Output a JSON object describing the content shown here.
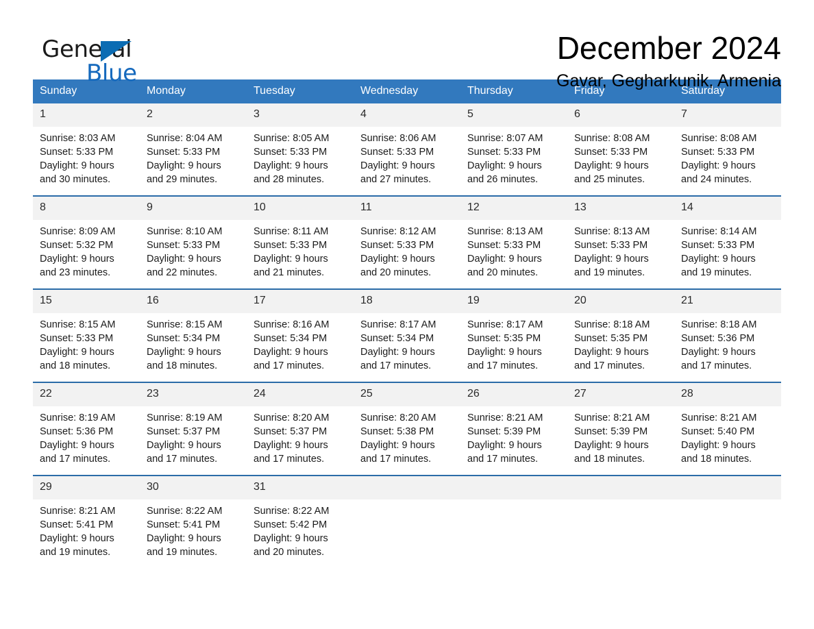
{
  "brand": {
    "name_part1": "General",
    "name_part2": "Blue",
    "triangle_icon": "triangle-icon",
    "accent_color": "#1569bd"
  },
  "header": {
    "title": "December 2024",
    "subtitle": "Gavar, Gegharkunik, Armenia"
  },
  "theme": {
    "header_row_bg": "#3279be",
    "daynum_bg": "#f2f2f2",
    "week_separator": "#2b6ca8"
  },
  "weekdays": [
    "Sunday",
    "Monday",
    "Tuesday",
    "Wednesday",
    "Thursday",
    "Friday",
    "Saturday"
  ],
  "weeks": [
    [
      {
        "day": "1",
        "sunrise": "Sunrise: 8:03 AM",
        "sunset": "Sunset: 5:33 PM",
        "daylight1": "Daylight: 9 hours",
        "daylight2": "and 30 minutes."
      },
      {
        "day": "2",
        "sunrise": "Sunrise: 8:04 AM",
        "sunset": "Sunset: 5:33 PM",
        "daylight1": "Daylight: 9 hours",
        "daylight2": "and 29 minutes."
      },
      {
        "day": "3",
        "sunrise": "Sunrise: 8:05 AM",
        "sunset": "Sunset: 5:33 PM",
        "daylight1": "Daylight: 9 hours",
        "daylight2": "and 28 minutes."
      },
      {
        "day": "4",
        "sunrise": "Sunrise: 8:06 AM",
        "sunset": "Sunset: 5:33 PM",
        "daylight1": "Daylight: 9 hours",
        "daylight2": "and 27 minutes."
      },
      {
        "day": "5",
        "sunrise": "Sunrise: 8:07 AM",
        "sunset": "Sunset: 5:33 PM",
        "daylight1": "Daylight: 9 hours",
        "daylight2": "and 26 minutes."
      },
      {
        "day": "6",
        "sunrise": "Sunrise: 8:08 AM",
        "sunset": "Sunset: 5:33 PM",
        "daylight1": "Daylight: 9 hours",
        "daylight2": "and 25 minutes."
      },
      {
        "day": "7",
        "sunrise": "Sunrise: 8:08 AM",
        "sunset": "Sunset: 5:33 PM",
        "daylight1": "Daylight: 9 hours",
        "daylight2": "and 24 minutes."
      }
    ],
    [
      {
        "day": "8",
        "sunrise": "Sunrise: 8:09 AM",
        "sunset": "Sunset: 5:32 PM",
        "daylight1": "Daylight: 9 hours",
        "daylight2": "and 23 minutes."
      },
      {
        "day": "9",
        "sunrise": "Sunrise: 8:10 AM",
        "sunset": "Sunset: 5:33 PM",
        "daylight1": "Daylight: 9 hours",
        "daylight2": "and 22 minutes."
      },
      {
        "day": "10",
        "sunrise": "Sunrise: 8:11 AM",
        "sunset": "Sunset: 5:33 PM",
        "daylight1": "Daylight: 9 hours",
        "daylight2": "and 21 minutes."
      },
      {
        "day": "11",
        "sunrise": "Sunrise: 8:12 AM",
        "sunset": "Sunset: 5:33 PM",
        "daylight1": "Daylight: 9 hours",
        "daylight2": "and 20 minutes."
      },
      {
        "day": "12",
        "sunrise": "Sunrise: 8:13 AM",
        "sunset": "Sunset: 5:33 PM",
        "daylight1": "Daylight: 9 hours",
        "daylight2": "and 20 minutes."
      },
      {
        "day": "13",
        "sunrise": "Sunrise: 8:13 AM",
        "sunset": "Sunset: 5:33 PM",
        "daylight1": "Daylight: 9 hours",
        "daylight2": "and 19 minutes."
      },
      {
        "day": "14",
        "sunrise": "Sunrise: 8:14 AM",
        "sunset": "Sunset: 5:33 PM",
        "daylight1": "Daylight: 9 hours",
        "daylight2": "and 19 minutes."
      }
    ],
    [
      {
        "day": "15",
        "sunrise": "Sunrise: 8:15 AM",
        "sunset": "Sunset: 5:33 PM",
        "daylight1": "Daylight: 9 hours",
        "daylight2": "and 18 minutes."
      },
      {
        "day": "16",
        "sunrise": "Sunrise: 8:15 AM",
        "sunset": "Sunset: 5:34 PM",
        "daylight1": "Daylight: 9 hours",
        "daylight2": "and 18 minutes."
      },
      {
        "day": "17",
        "sunrise": "Sunrise: 8:16 AM",
        "sunset": "Sunset: 5:34 PM",
        "daylight1": "Daylight: 9 hours",
        "daylight2": "and 17 minutes."
      },
      {
        "day": "18",
        "sunrise": "Sunrise: 8:17 AM",
        "sunset": "Sunset: 5:34 PM",
        "daylight1": "Daylight: 9 hours",
        "daylight2": "and 17 minutes."
      },
      {
        "day": "19",
        "sunrise": "Sunrise: 8:17 AM",
        "sunset": "Sunset: 5:35 PM",
        "daylight1": "Daylight: 9 hours",
        "daylight2": "and 17 minutes."
      },
      {
        "day": "20",
        "sunrise": "Sunrise: 8:18 AM",
        "sunset": "Sunset: 5:35 PM",
        "daylight1": "Daylight: 9 hours",
        "daylight2": "and 17 minutes."
      },
      {
        "day": "21",
        "sunrise": "Sunrise: 8:18 AM",
        "sunset": "Sunset: 5:36 PM",
        "daylight1": "Daylight: 9 hours",
        "daylight2": "and 17 minutes."
      }
    ],
    [
      {
        "day": "22",
        "sunrise": "Sunrise: 8:19 AM",
        "sunset": "Sunset: 5:36 PM",
        "daylight1": "Daylight: 9 hours",
        "daylight2": "and 17 minutes."
      },
      {
        "day": "23",
        "sunrise": "Sunrise: 8:19 AM",
        "sunset": "Sunset: 5:37 PM",
        "daylight1": "Daylight: 9 hours",
        "daylight2": "and 17 minutes."
      },
      {
        "day": "24",
        "sunrise": "Sunrise: 8:20 AM",
        "sunset": "Sunset: 5:37 PM",
        "daylight1": "Daylight: 9 hours",
        "daylight2": "and 17 minutes."
      },
      {
        "day": "25",
        "sunrise": "Sunrise: 8:20 AM",
        "sunset": "Sunset: 5:38 PM",
        "daylight1": "Daylight: 9 hours",
        "daylight2": "and 17 minutes."
      },
      {
        "day": "26",
        "sunrise": "Sunrise: 8:21 AM",
        "sunset": "Sunset: 5:39 PM",
        "daylight1": "Daylight: 9 hours",
        "daylight2": "and 17 minutes."
      },
      {
        "day": "27",
        "sunrise": "Sunrise: 8:21 AM",
        "sunset": "Sunset: 5:39 PM",
        "daylight1": "Daylight: 9 hours",
        "daylight2": "and 18 minutes."
      },
      {
        "day": "28",
        "sunrise": "Sunrise: 8:21 AM",
        "sunset": "Sunset: 5:40 PM",
        "daylight1": "Daylight: 9 hours",
        "daylight2": "and 18 minutes."
      }
    ],
    [
      {
        "day": "29",
        "sunrise": "Sunrise: 8:21 AM",
        "sunset": "Sunset: 5:41 PM",
        "daylight1": "Daylight: 9 hours",
        "daylight2": "and 19 minutes."
      },
      {
        "day": "30",
        "sunrise": "Sunrise: 8:22 AM",
        "sunset": "Sunset: 5:41 PM",
        "daylight1": "Daylight: 9 hours",
        "daylight2": "and 19 minutes."
      },
      {
        "day": "31",
        "sunrise": "Sunrise: 8:22 AM",
        "sunset": "Sunset: 5:42 PM",
        "daylight1": "Daylight: 9 hours",
        "daylight2": "and 20 minutes."
      },
      {
        "day": "",
        "sunrise": "",
        "sunset": "",
        "daylight1": "",
        "daylight2": ""
      },
      {
        "day": "",
        "sunrise": "",
        "sunset": "",
        "daylight1": "",
        "daylight2": ""
      },
      {
        "day": "",
        "sunrise": "",
        "sunset": "",
        "daylight1": "",
        "daylight2": ""
      },
      {
        "day": "",
        "sunrise": "",
        "sunset": "",
        "daylight1": "",
        "daylight2": ""
      }
    ]
  ]
}
